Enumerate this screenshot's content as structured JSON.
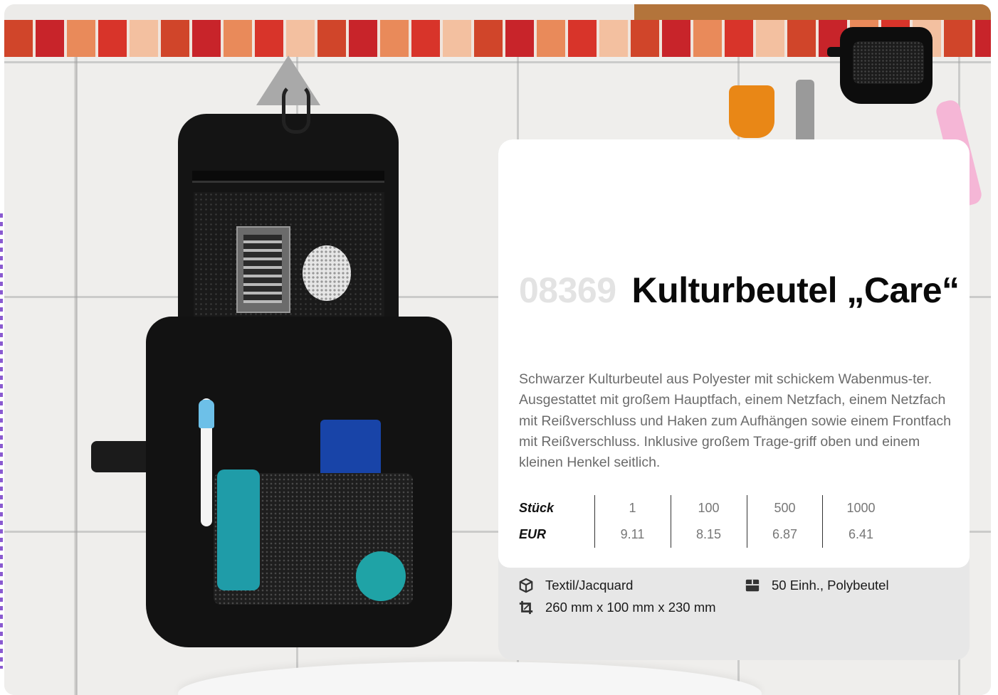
{
  "product": {
    "article_number": "08369",
    "name": "Kulturbeutel „Care“",
    "description": "Schwarzer Kulturbeutel aus Polyester mit schickem Wabenmus-ter. Ausgestattet mit großem Hauptfach, einem Netzfach, einem Netzfach mit Reißverschluss und Haken zum Aufhängen sowie einem Frontfach mit Reißverschluss. Inklusive großem Trage-griff oben und einem kleinen Henkel seitlich."
  },
  "price_table": {
    "row_labels": [
      "Stück",
      "EUR"
    ],
    "quantities": [
      "1",
      "100",
      "500",
      "1000"
    ],
    "prices": [
      "9.11",
      "8.15",
      "6.87",
      "6.41"
    ]
  },
  "specs": {
    "material": "Textil/Jacquard",
    "dimensions": "260 mm x 100 mm x 230 mm",
    "packaging": "50 Einh., Polybeutel",
    "material_icon": "box-icon",
    "dimensions_icon": "crop-icon",
    "packaging_icon": "carton-icon"
  },
  "colors": {
    "title": "#0a0a0a",
    "article_number": "#e3e3e3",
    "body_text": "#6b6b6b",
    "card_bottom": "#e7e7e7"
  }
}
